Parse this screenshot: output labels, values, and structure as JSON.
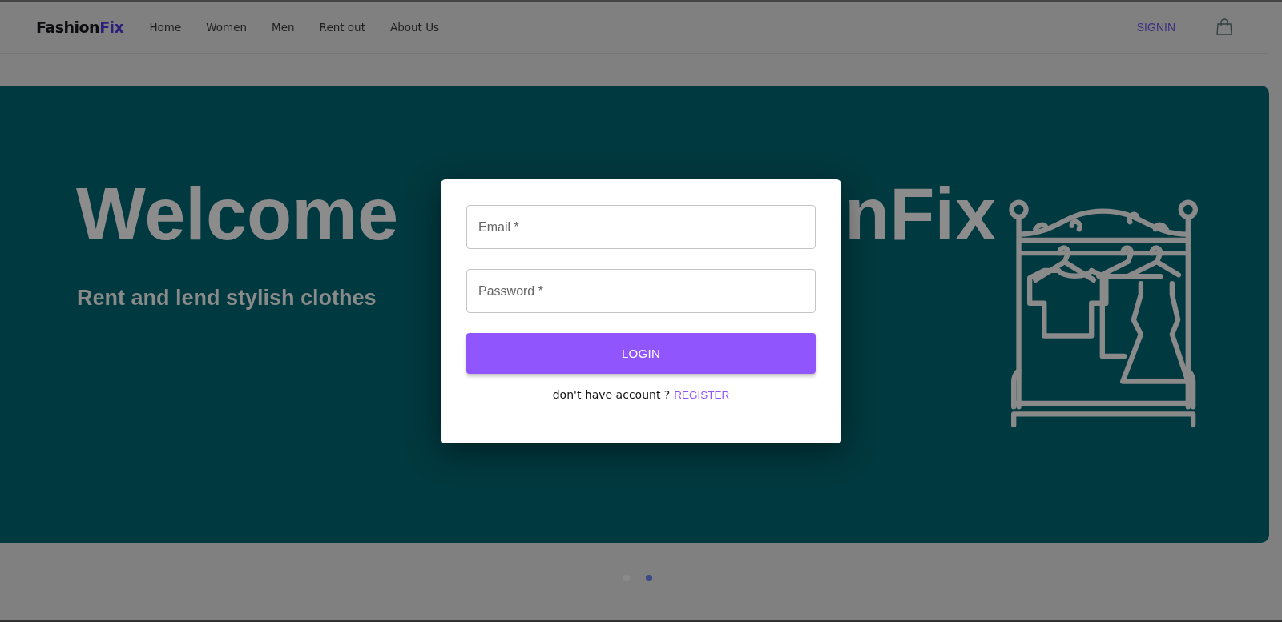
{
  "header": {
    "logo": {
      "dark": "Fashion",
      "accent": "Fix"
    },
    "nav": [
      {
        "label": "Home"
      },
      {
        "label": "Women"
      },
      {
        "label": "Men"
      },
      {
        "label": "Rent out"
      },
      {
        "label": "About Us"
      }
    ],
    "signin": "SIGNIN"
  },
  "hero": {
    "title_visible_start": "Welcome",
    "title_visible_end": "nFix",
    "subtitle": "Rent and lend stylish clothes",
    "dots": [
      {
        "selected": false
      },
      {
        "selected": true
      }
    ]
  },
  "login_dialog": {
    "fields": [
      {
        "placeholder": "Email *"
      },
      {
        "placeholder": "Password *"
      }
    ],
    "button": "LOGIN",
    "prompt": "don't have account ?",
    "link": "REGISTER"
  }
}
